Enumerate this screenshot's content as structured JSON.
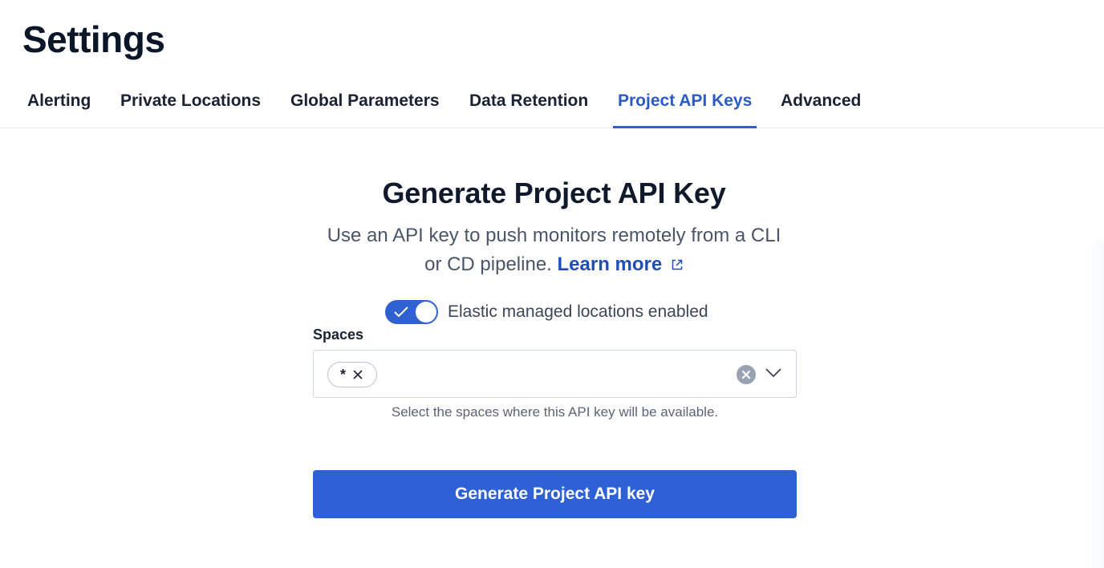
{
  "page": {
    "title": "Settings"
  },
  "tabs": [
    {
      "label": "Alerting",
      "active": false
    },
    {
      "label": "Private Locations",
      "active": false
    },
    {
      "label": "Global Parameters",
      "active": false
    },
    {
      "label": "Data Retention",
      "active": false
    },
    {
      "label": "Project API Keys",
      "active": true
    },
    {
      "label": "Advanced",
      "active": false
    }
  ],
  "main": {
    "heading": "Generate Project API Key",
    "description_line1": "Use an API key to push monitors remotely from a CLI",
    "description_line2": "or CD pipeline.",
    "learn_more": "Learn more",
    "toggle": {
      "label": "Elastic managed locations enabled",
      "checked": true
    },
    "spaces": {
      "label": "Spaces",
      "selected": [
        "*"
      ],
      "help": "Select the spaces where this API key will be available."
    },
    "generate_button": "Generate Project API key"
  },
  "colors": {
    "accent": "#2e61d6",
    "active_tab": "#2b5bc6",
    "link": "#1f4fb6"
  },
  "icons": {
    "external_link": "external-link-icon",
    "check": "check-icon",
    "chip_remove": "close-icon",
    "clear": "clear-icon",
    "dropdown": "chevron-down-icon"
  }
}
